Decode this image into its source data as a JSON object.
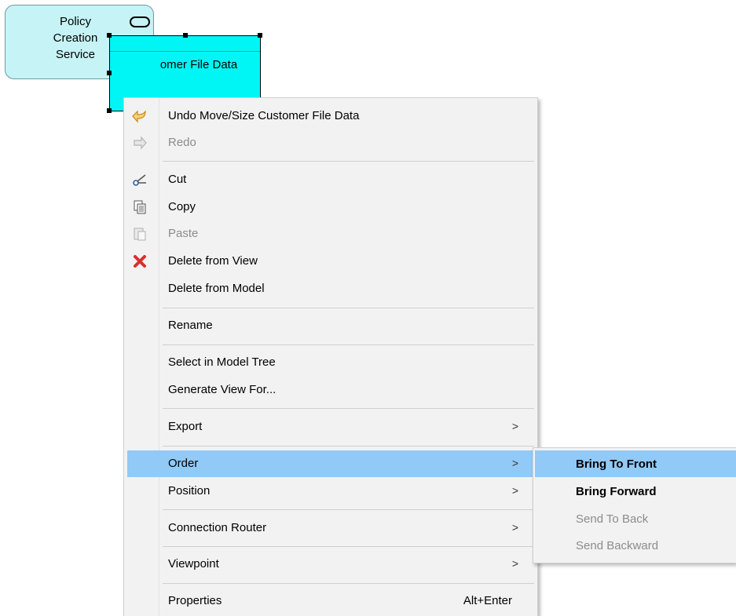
{
  "canvas": {
    "service_element": {
      "label_lines": [
        "Policy",
        "Creation",
        "Service"
      ],
      "icon": "service-icon"
    },
    "data_object": {
      "label": "Customer File Data",
      "visible_label": "omer File Data",
      "color": "#00f5f5"
    }
  },
  "context_menu": {
    "items": {
      "undo": {
        "label": "Undo Move/Size Customer File Data",
        "icon": "undo-arrow-icon"
      },
      "redo": {
        "label": "Redo",
        "icon": "redo-arrow-icon",
        "enabled": false
      },
      "cut": {
        "label": "Cut",
        "icon": "scissors-icon"
      },
      "copy": {
        "label": "Copy",
        "icon": "copy-icon"
      },
      "paste": {
        "label": "Paste",
        "icon": "paste-icon",
        "enabled": false
      },
      "delete_view": {
        "label": "Delete from View",
        "icon": "delete-x-icon"
      },
      "delete_model": {
        "label": "Delete from Model"
      },
      "rename": {
        "label": "Rename"
      },
      "select_tree": {
        "label": "Select in Model Tree"
      },
      "generate_view": {
        "label": "Generate View For..."
      },
      "export": {
        "label": "Export",
        "submenu": ">"
      },
      "order": {
        "label": "Order",
        "submenu": ">",
        "highlighted": true
      },
      "position": {
        "label": "Position",
        "submenu": ">"
      },
      "connection_router": {
        "label": "Connection Router",
        "submenu": ">"
      },
      "viewpoint": {
        "label": "Viewpoint",
        "submenu": ">"
      },
      "properties": {
        "label": "Properties",
        "shortcut": "Alt+Enter"
      }
    }
  },
  "order_submenu": {
    "items": {
      "bring_to_front": {
        "label": "Bring To Front",
        "highlighted": true
      },
      "bring_forward": {
        "label": "Bring Forward"
      },
      "send_to_back": {
        "label": "Send To Back",
        "enabled": false
      },
      "send_backward": {
        "label": "Send Backward",
        "enabled": false
      }
    }
  },
  "colors": {
    "highlight": "#91c9f7",
    "menu_bg": "#f2f2f2",
    "service_fill": "#c6f3f5"
  }
}
